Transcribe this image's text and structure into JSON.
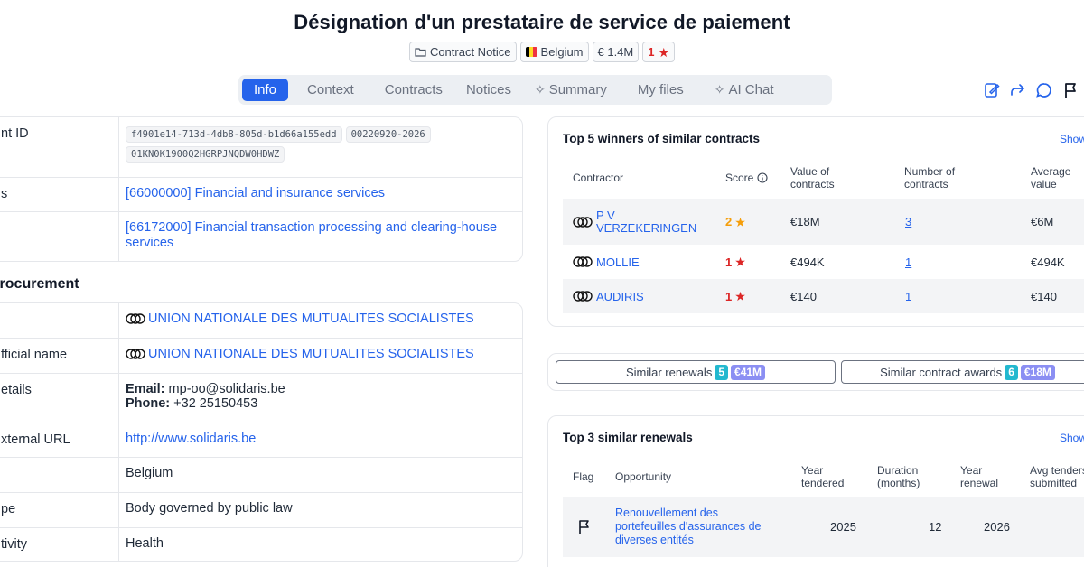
{
  "title": "Désignation d'un prestataire de service de paiement",
  "badges": {
    "type": "Contract Notice",
    "country": "Belgium",
    "value": "€ 1.4M",
    "rating": "1"
  },
  "tabs": [
    "Info",
    "Context",
    "Contracts",
    "Notices",
    "Summary",
    "My files",
    "AI Chat"
  ],
  "actions": [
    "edit-icon",
    "share-icon",
    "comment-icon",
    "flag-icon"
  ],
  "details": {
    "rows": [
      {
        "label": "nt ID",
        "ids": [
          "f4901e14-713d-4db8-805d-b1d66a155edd",
          "00220920-2026",
          "01KN0K1900Q2HGRPJNQDW0HDWZ"
        ]
      },
      {
        "label": "s",
        "value": "[66000000] Financial and insurance services"
      },
      {
        "label": "",
        "value": "[66172000] Financial transaction processing and clearing-house services"
      }
    ]
  },
  "procurement": {
    "section_title": "f procurement",
    "rows": [
      {
        "label": "",
        "value": "UNION NATIONALE DES MUTUALITES SOCIALISTES"
      },
      {
        "label": "fficial name",
        "value": "UNION NATIONALE DES MUTUALITES SOCIALISTES"
      },
      {
        "label": "etails",
        "email_label": "Email:",
        "email": "mp-oo@solidaris.be",
        "phone_label": "Phone:",
        "phone": "+32 25150453"
      },
      {
        "label": "xternal URL",
        "value": "http://www.solidaris.be"
      },
      {
        "label": "",
        "value": "Belgium"
      },
      {
        "label": "pe",
        "value": "Body governed by public law"
      },
      {
        "label": "tivity",
        "value": "Health"
      }
    ]
  },
  "winners": {
    "title": "Top 5 winners of similar contracts",
    "show": "Show",
    "headers": [
      "Contractor",
      "Score",
      "Value of contracts",
      "Number of contracts",
      "Average value"
    ],
    "rows": [
      {
        "name": "P V VERZEKERINGEN",
        "score": "2",
        "value": "€18M",
        "count": "3",
        "avg": "€6M"
      },
      {
        "name": "MOLLIE",
        "score": "1",
        "value": "€494K",
        "count": "1",
        "avg": "€494K"
      },
      {
        "name": "AUDIRIS",
        "score": "1",
        "value": "€140",
        "count": "1",
        "avg": "€140"
      }
    ]
  },
  "similar": {
    "renewals_label": "Similar renewals",
    "renewals_count": "5",
    "renewals_value": "€41M",
    "awards_label": "Similar contract awards",
    "awards_count": "6",
    "awards_value": "€18M"
  },
  "renewals": {
    "title": "Top 3 similar renewals",
    "show": "Show",
    "headers": [
      "Flag",
      "Opportunity",
      "Year tendered",
      "Duration (months)",
      "Year renewal",
      "Avg tenders submitted"
    ],
    "rows": [
      {
        "opportunity": "Renouvellement des portefeuilles d'assurances de diverses entités",
        "year": "2025",
        "duration": "12",
        "renewal": "2026"
      }
    ]
  },
  "colors": {
    "accent": "#2563eb",
    "rating_red": "#dc2626",
    "rating_orange": "#f59e0b",
    "teal": "#22b8cf",
    "purple": "#8b8ff3"
  }
}
